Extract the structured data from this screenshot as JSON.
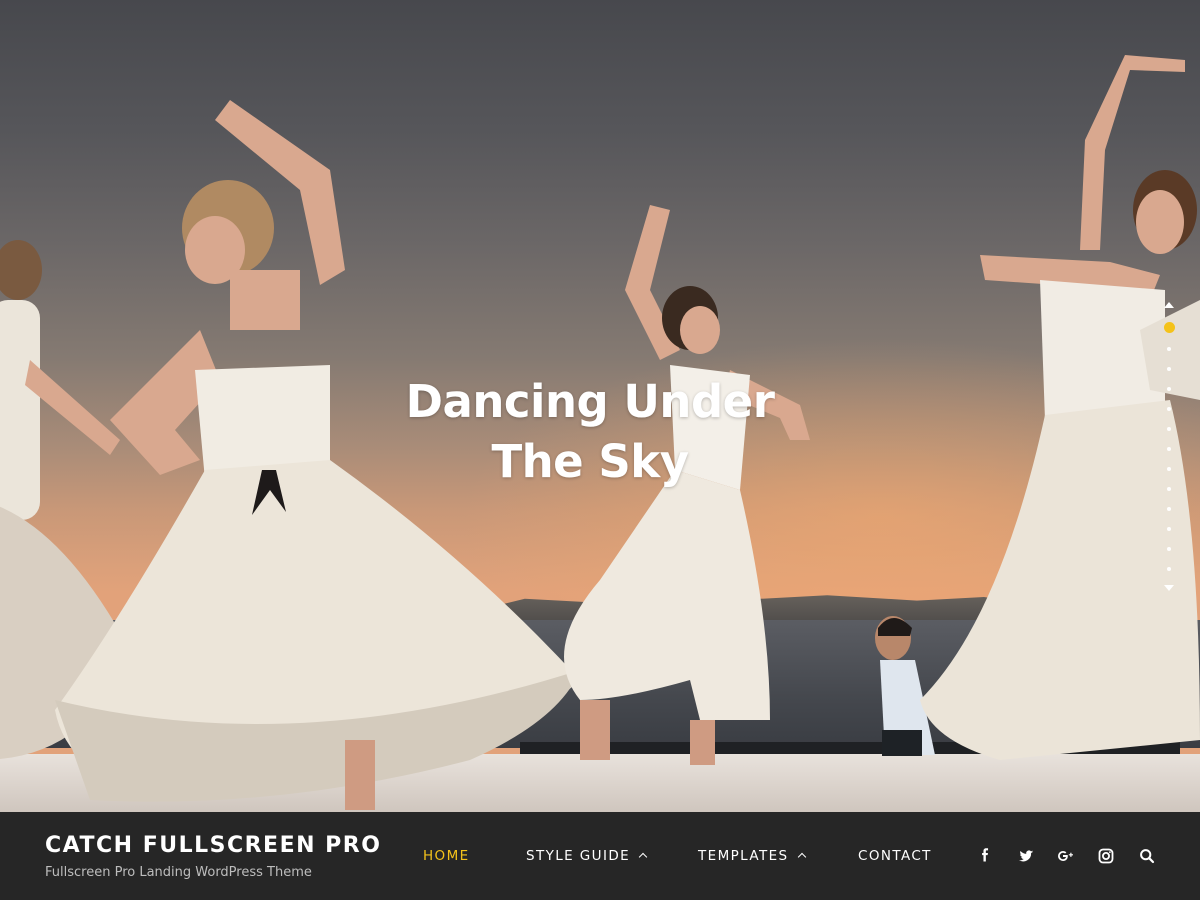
{
  "hero": {
    "title_line1": "Dancing Under",
    "title_line2": "The Sky"
  },
  "slider": {
    "total_dots": 13,
    "active_index": 0,
    "active_color": "#f4c21a"
  },
  "site": {
    "title": "CATCH FULLSCREEN PRO",
    "tagline": "Fullscreen Pro Landing WordPress Theme"
  },
  "nav": {
    "items": [
      {
        "label": "HOME",
        "active": true,
        "has_submenu": false
      },
      {
        "label": "STYLE GUIDE",
        "active": false,
        "has_submenu": true
      },
      {
        "label": "TEMPLATES",
        "active": false,
        "has_submenu": true
      },
      {
        "label": "CONTACT",
        "active": false,
        "has_submenu": false
      }
    ],
    "accent_color": "#f4c21a"
  },
  "social": {
    "icons": [
      "facebook-icon",
      "twitter-icon",
      "google-plus-icon",
      "instagram-icon",
      "search-icon"
    ]
  }
}
